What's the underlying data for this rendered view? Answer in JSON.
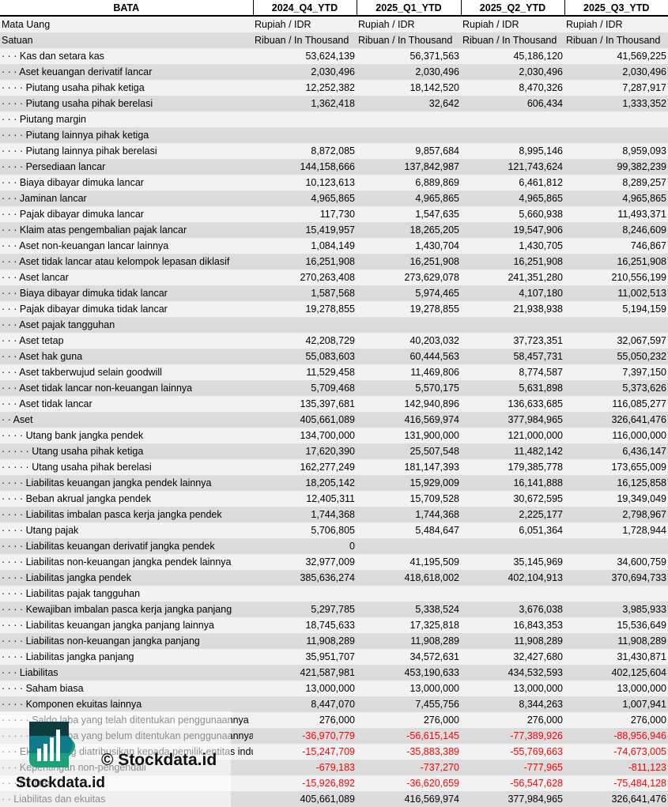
{
  "header": {
    "title": "BATA",
    "periods": [
      "2024_Q4_YTD",
      "2025_Q1_YTD",
      "2025_Q2_YTD",
      "2025_Q3_YTD"
    ]
  },
  "meta_rows": [
    {
      "label": "Mata Uang",
      "values": [
        "Rupiah / IDR",
        "Rupiah / IDR",
        "Rupiah / IDR",
        "Rupiah / IDR"
      ]
    },
    {
      "label": "Satuan",
      "values": [
        "Ribuan / In Thousand",
        "Ribuan / In Thousand",
        "Ribuan / In Thousand",
        "Ribuan / In Thousand"
      ]
    }
  ],
  "rows": [
    {
      "indent": "· · ·",
      "label": "Kas dan setara kas",
      "values": [
        "53,624,139",
        "56,371,563",
        "45,186,120",
        "41,569,225"
      ]
    },
    {
      "indent": "· · ·",
      "label": "Aset keuangan derivatif lancar",
      "values": [
        "2,030,496",
        "2,030,496",
        "2,030,496",
        "2,030,496"
      ]
    },
    {
      "indent": "· · · ·",
      "label": "Piutang usaha pihak ketiga",
      "values": [
        "12,252,382",
        "18,142,520",
        "8,470,326",
        "7,287,917"
      ]
    },
    {
      "indent": "· · · ·",
      "label": "Piutang usaha pihak berelasi",
      "values": [
        "1,362,418",
        "32,642",
        "606,434",
        "1,333,352"
      ]
    },
    {
      "indent": "· · ·",
      "label": "Piutang margin",
      "values": [
        "",
        "",
        "",
        ""
      ]
    },
    {
      "indent": "· · · ·",
      "label": "Piutang lainnya pihak ketiga",
      "values": [
        "",
        "",
        "",
        ""
      ]
    },
    {
      "indent": "· · · ·",
      "label": "Piutang lainnya pihak berelasi",
      "values": [
        "8,872,085",
        "9,857,684",
        "8,995,146",
        "8,959,093"
      ]
    },
    {
      "indent": "· · · ·",
      "label": "Persediaan lancar",
      "values": [
        "144,158,666",
        "137,842,987",
        "121,743,624",
        "99,382,239"
      ]
    },
    {
      "indent": "· · ·",
      "label": "Biaya dibayar dimuka lancar",
      "values": [
        "10,123,613",
        "6,889,869",
        "6,461,812",
        "8,289,257"
      ]
    },
    {
      "indent": "· · ·",
      "label": "Jaminan lancar",
      "values": [
        "4,965,865",
        "4,965,865",
        "4,965,865",
        "4,965,865"
      ]
    },
    {
      "indent": "· · ·",
      "label": "Pajak dibayar dimuka lancar",
      "values": [
        "117,730",
        "1,547,635",
        "5,660,938",
        "11,493,371"
      ]
    },
    {
      "indent": "· · ·",
      "label": "Klaim atas pengembalian pajak lancar",
      "values": [
        "15,419,957",
        "18,265,205",
        "19,547,906",
        "8,246,609"
      ]
    },
    {
      "indent": "· · ·",
      "label": "Aset non-keuangan lancar lainnya",
      "values": [
        "1,084,149",
        "1,430,704",
        "1,430,705",
        "746,867"
      ]
    },
    {
      "indent": "· · ·",
      "label": "Aset tidak lancar atau kelompok lepasan diklasif",
      "values": [
        "16,251,908",
        "16,251,908",
        "16,251,908",
        "16,251,908"
      ]
    },
    {
      "indent": "· · ·",
      "label": "Aset lancar",
      "values": [
        "270,263,408",
        "273,629,078",
        "241,351,280",
        "210,556,199"
      ]
    },
    {
      "indent": "· · ·",
      "label": "Biaya dibayar dimuka tidak lancar",
      "values": [
        "1,587,568",
        "5,974,465",
        "4,107,180",
        "11,002,513"
      ]
    },
    {
      "indent": "· · ·",
      "label": "Pajak dibayar dimuka tidak lancar",
      "values": [
        "19,278,855",
        "19,278,855",
        "21,938,938",
        "5,194,159"
      ]
    },
    {
      "indent": "· · ·",
      "label": "Aset pajak tangguhan",
      "values": [
        "",
        "",
        "",
        ""
      ]
    },
    {
      "indent": "· · ·",
      "label": "Aset tetap",
      "values": [
        "42,208,729",
        "40,203,032",
        "37,723,351",
        "32,067,597"
      ]
    },
    {
      "indent": "· · ·",
      "label": "Aset hak guna",
      "values": [
        "55,083,603",
        "60,444,563",
        "58,457,731",
        "55,050,232"
      ]
    },
    {
      "indent": "· · ·",
      "label": "Aset takberwujud selain goodwill",
      "values": [
        "11,529,458",
        "11,469,806",
        "8,774,587",
        "7,397,150"
      ]
    },
    {
      "indent": "· · ·",
      "label": "Aset tidak lancar non-keuangan lainnya",
      "values": [
        "5,709,468",
        "5,570,175",
        "5,631,898",
        "5,373,626"
      ]
    },
    {
      "indent": "· · ·",
      "label": "Aset tidak lancar",
      "values": [
        "135,397,681",
        "142,940,896",
        "136,633,685",
        "116,085,277"
      ]
    },
    {
      "indent": "· ·",
      "label": "Aset",
      "values": [
        "405,661,089",
        "416,569,974",
        "377,984,965",
        "326,641,476"
      ]
    },
    {
      "indent": "· · · ·",
      "label": "Utang bank jangka pendek",
      "values": [
        "134,700,000",
        "131,900,000",
        "121,000,000",
        "116,000,000"
      ]
    },
    {
      "indent": "· · · · ·",
      "label": "Utang usaha pihak ketiga",
      "values": [
        "17,620,390",
        "25,507,548",
        "11,482,142",
        "6,436,147"
      ]
    },
    {
      "indent": "· · · · ·",
      "label": "Utang usaha pihak berelasi",
      "values": [
        "162,277,249",
        "181,147,393",
        "179,385,778",
        "173,655,009"
      ]
    },
    {
      "indent": "· · · ·",
      "label": "Liabilitas keuangan jangka pendek lainnya",
      "values": [
        "18,205,142",
        "15,929,009",
        "16,141,888",
        "16,125,858"
      ]
    },
    {
      "indent": "· · · ·",
      "label": "Beban akrual jangka pendek",
      "values": [
        "12,405,311",
        "15,709,528",
        "30,672,595",
        "19,349,049"
      ]
    },
    {
      "indent": "· · · ·",
      "label": "Liabilitas imbalan pasca kerja jangka pendek",
      "values": [
        "1,744,368",
        "1,744,368",
        "2,225,177",
        "2,798,967"
      ]
    },
    {
      "indent": "· · · ·",
      "label": "Utang pajak",
      "values": [
        "5,706,805",
        "5,484,647",
        "6,051,364",
        "1,728,944"
      ]
    },
    {
      "indent": "· · · ·",
      "label": "Liabilitas keuangan derivatif jangka pendek",
      "values": [
        "0",
        "",
        "",
        ""
      ]
    },
    {
      "indent": "· · · ·",
      "label": "Liabilitas non-keuangan jangka pendek lainnya",
      "values": [
        "32,977,009",
        "41,195,509",
        "35,145,969",
        "34,600,759"
      ]
    },
    {
      "indent": "· · · ·",
      "label": "Liabilitas jangka pendek",
      "values": [
        "385,636,274",
        "418,618,002",
        "402,104,913",
        "370,694,733"
      ]
    },
    {
      "indent": "· · · ·",
      "label": "Liabilitas pajak tangguhan",
      "values": [
        "",
        "",
        "",
        ""
      ]
    },
    {
      "indent": "· · · ·",
      "label": "Kewajiban imbalan pasca kerja jangka panjang",
      "values": [
        "5,297,785",
        "5,338,524",
        "3,676,038",
        "3,985,933"
      ]
    },
    {
      "indent": "· · · ·",
      "label": "Liabilitas keuangan jangka panjang lainnya",
      "values": [
        "18,745,633",
        "17,325,818",
        "16,843,353",
        "15,536,649"
      ]
    },
    {
      "indent": "· · · ·",
      "label": "Liabilitas non-keuangan jangka panjang",
      "values": [
        "11,908,289",
        "11,908,289",
        "11,908,289",
        "11,908,289"
      ]
    },
    {
      "indent": "· · · ·",
      "label": "Liabilitas jangka panjang",
      "values": [
        "35,951,707",
        "34,572,631",
        "32,427,680",
        "31,430,871"
      ]
    },
    {
      "indent": "· · ·",
      "label": "Liabilitas",
      "values": [
        "421,587,981",
        "453,190,633",
        "434,532,593",
        "402,125,604"
      ]
    },
    {
      "indent": "· · · ·",
      "label": "Saham biasa",
      "values": [
        "13,000,000",
        "13,000,000",
        "13,000,000",
        "13,000,000"
      ]
    },
    {
      "indent": "· · · ·",
      "label": "Komponen ekuitas lainnya",
      "values": [
        "8,447,070",
        "7,455,756",
        "8,344,263",
        "1,007,941"
      ]
    },
    {
      "indent": "· · · · ·",
      "label": "Saldo laba yang telah ditentukan penggunaannya",
      "values": [
        "276,000",
        "276,000",
        "276,000",
        "276,000"
      ]
    },
    {
      "indent": "· · · · ·",
      "label": "Saldo laba yang belum ditentukan penggunaannya",
      "values": [
        "-36,970,779",
        "-56,615,145",
        "-77,389,926",
        "-88,956,946"
      ]
    },
    {
      "indent": "· · ·",
      "label": "Ekuitas yang diatribusikan kepada pemilik entitas induk",
      "values": [
        "-15,247,709",
        "-35,883,389",
        "-55,769,663",
        "-74,673,005"
      ]
    },
    {
      "indent": "· · ·",
      "label": "Kepentingan non-pengendali",
      "values": [
        "-679,183",
        "-737,270",
        "-777,965",
        "-811,123"
      ]
    },
    {
      "indent": "· · ·",
      "label": "Ekuitas",
      "values": [
        "-15,926,892",
        "-36,620,659",
        "-56,547,628",
        "-75,484,128"
      ]
    },
    {
      "indent": "· ·",
      "label": "Liabilitas dan ekuitas",
      "values": [
        "405,661,089",
        "416,569,974",
        "377,984,965",
        "326,641,476"
      ]
    }
  ],
  "watermark": {
    "copyright": "© Stockdata.id",
    "brand": "Stockdata.id"
  },
  "colors": {
    "negative": "#ff0000",
    "row_light": "#f2f2f2",
    "row_dark": "#dcdcdc",
    "logo_dark": "#0d3b3e",
    "logo_mid": "#0f7a8a",
    "logo_green": "#1aa37a"
  }
}
